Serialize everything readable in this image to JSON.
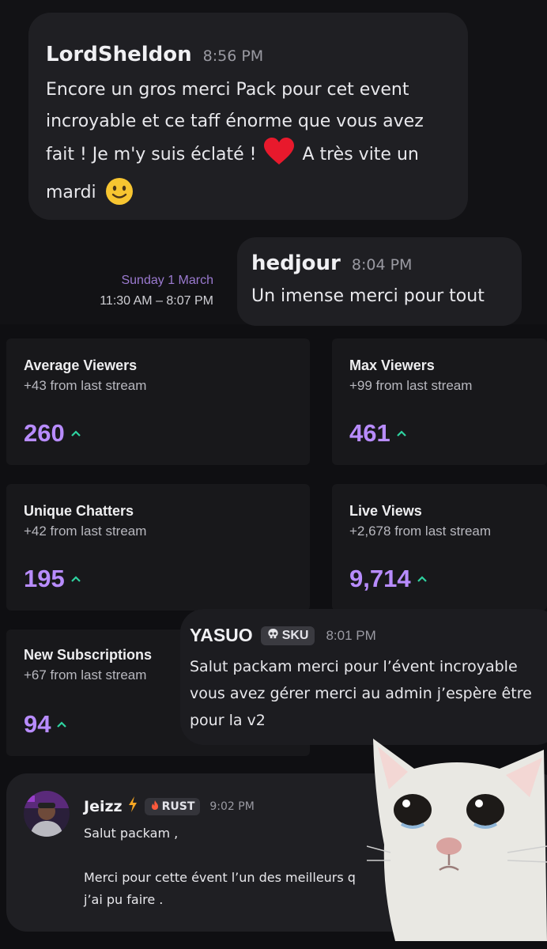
{
  "messages": {
    "lordsheldon": {
      "author": "LordSheldon",
      "time": "8:56 PM",
      "line1": "Encore un gros merci Pack pour cet event",
      "line2": "incroyable et ce taff énorme que vous avez",
      "line3a": "fait ! Je m'y suis éclaté !",
      "line3b": "A très vite un",
      "line4": "mardi"
    },
    "hedjour": {
      "author": "hedjour",
      "time": "8:04 PM",
      "text": "Un imense merci pour tout"
    },
    "yasuo": {
      "author": "YASUO",
      "badge": "SKU",
      "time": "8:01 PM",
      "line1": "Salut packam merci pour l’évent incroyable",
      "line2": "vous avez gérer merci au admin j’espère être",
      "line3": "pour la v2"
    },
    "jeizz": {
      "author": "Jeizz",
      "badge": "RUST",
      "time": "9:02 PM",
      "line1": "Salut packam ,",
      "line2": "Merci pour cette évent l’un des meilleurs q",
      "line3": "j’ai pu faire ."
    }
  },
  "stream": {
    "date": "Sunday 1 March",
    "range": "11:30 AM – 8:07 PM"
  },
  "stats": [
    {
      "title": "Average Viewers",
      "delta": "+43 from last stream",
      "value": "260"
    },
    {
      "title": "Max Viewers",
      "delta": "+99 from last stream",
      "value": "461"
    },
    {
      "title": "Unique Chatters",
      "delta": "+42 from last stream",
      "value": "195"
    },
    {
      "title": "Live Views",
      "delta": "+2,678 from last stream",
      "value": "9,714"
    },
    {
      "title": "New Subscriptions",
      "delta": "+67 from last stream",
      "value": "94"
    }
  ],
  "icons": {
    "heart": "heart-icon",
    "smiley": "smiley-icon",
    "skull": "skull-icon",
    "flame": "flame-icon",
    "lightning": "lightning-icon",
    "up": "arrow-up-icon"
  },
  "colors": {
    "accent_purple": "#b88cff",
    "up_green": "#2ed3a0",
    "heart_red": "#e8192c"
  }
}
